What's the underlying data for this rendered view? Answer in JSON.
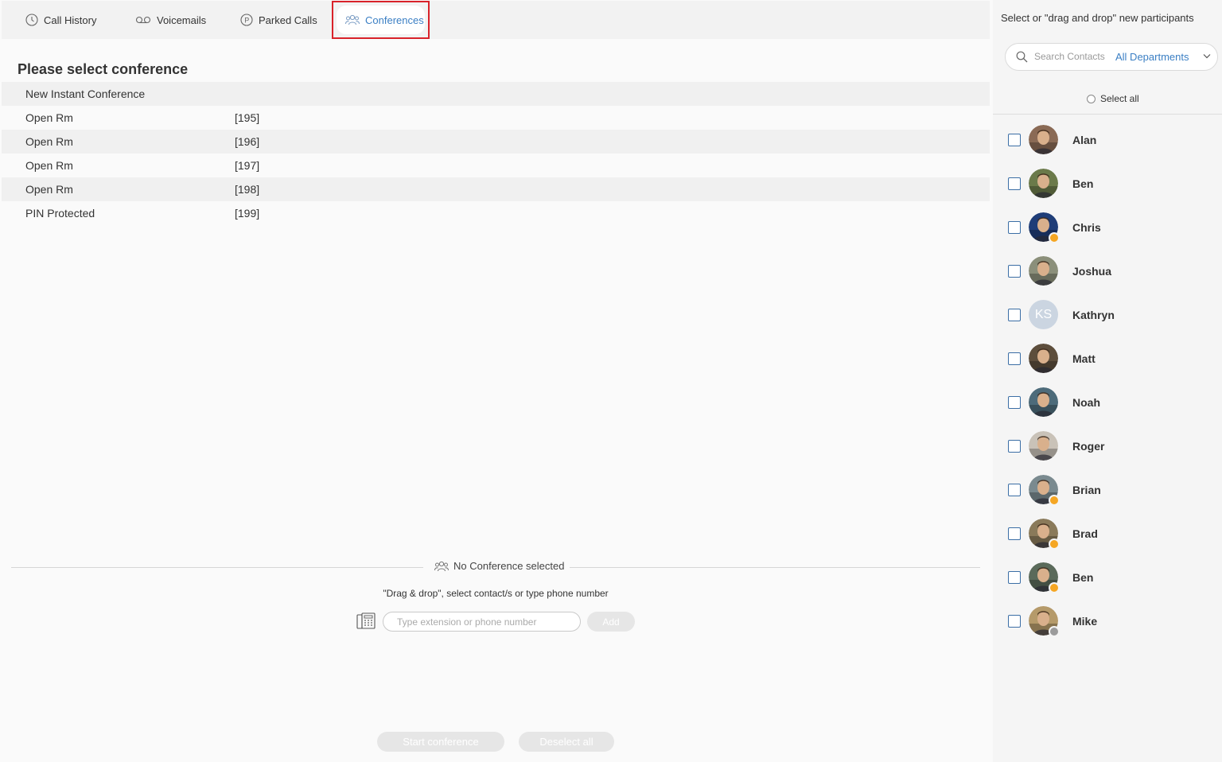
{
  "tabs": [
    {
      "label": "Call History",
      "icon": "clock-icon"
    },
    {
      "label": "Voicemails",
      "icon": "voicemail-icon"
    },
    {
      "label": "Parked Calls",
      "icon": "parking-icon"
    },
    {
      "label": "Conferences",
      "icon": "group-icon",
      "active": true
    }
  ],
  "main": {
    "title": "Please select conference",
    "conferences": [
      {
        "name": "New Instant Conference",
        "number": ""
      },
      {
        "name": "Open Rm",
        "number": "[195]"
      },
      {
        "name": "Open Rm",
        "number": "[196]"
      },
      {
        "name": "Open Rm",
        "number": "[197]"
      },
      {
        "name": "Open Rm",
        "number": "[198]"
      },
      {
        "name": "PIN Protected",
        "number": "[199]"
      }
    ],
    "no_conference_text": "No Conference selected",
    "hint": "\"Drag & drop\", select contact/s or type phone number",
    "phone_placeholder": "Type extension or phone number",
    "add_label": "Add",
    "start_label": "Start conference",
    "deselect_label": "Deselect all"
  },
  "sidebar": {
    "title": "Select or \"drag and drop\" new participants",
    "search_placeholder": "Search Contacts",
    "department": "All Departments",
    "select_all": "Select all",
    "contacts": [
      {
        "name": "Alan",
        "status": "",
        "initials": "",
        "color": "#8a6a55"
      },
      {
        "name": "Ben",
        "status": "",
        "initials": "",
        "color": "#6b7a4a"
      },
      {
        "name": "Chris",
        "status": "away",
        "initials": "",
        "color": "#1f3d78"
      },
      {
        "name": "Joshua",
        "status": "",
        "initials": "",
        "color": "#8b8f7a"
      },
      {
        "name": "Kathryn",
        "status": "",
        "initials": "KS",
        "color": "#cbd5e1"
      },
      {
        "name": "Matt",
        "status": "",
        "initials": "",
        "color": "#5d4e3c"
      },
      {
        "name": "Noah",
        "status": "",
        "initials": "",
        "color": "#4d6b7a"
      },
      {
        "name": "Roger",
        "status": "",
        "initials": "",
        "color": "#c9c2b8"
      },
      {
        "name": "Brian",
        "status": "away",
        "initials": "",
        "color": "#7a8a8f"
      },
      {
        "name": "Brad",
        "status": "away",
        "initials": "",
        "color": "#8a7a5a"
      },
      {
        "name": "Ben",
        "status": "away",
        "initials": "",
        "color": "#5a6a5a"
      },
      {
        "name": "Mike",
        "status": "offline",
        "initials": "",
        "color": "#b59a6a"
      }
    ]
  }
}
